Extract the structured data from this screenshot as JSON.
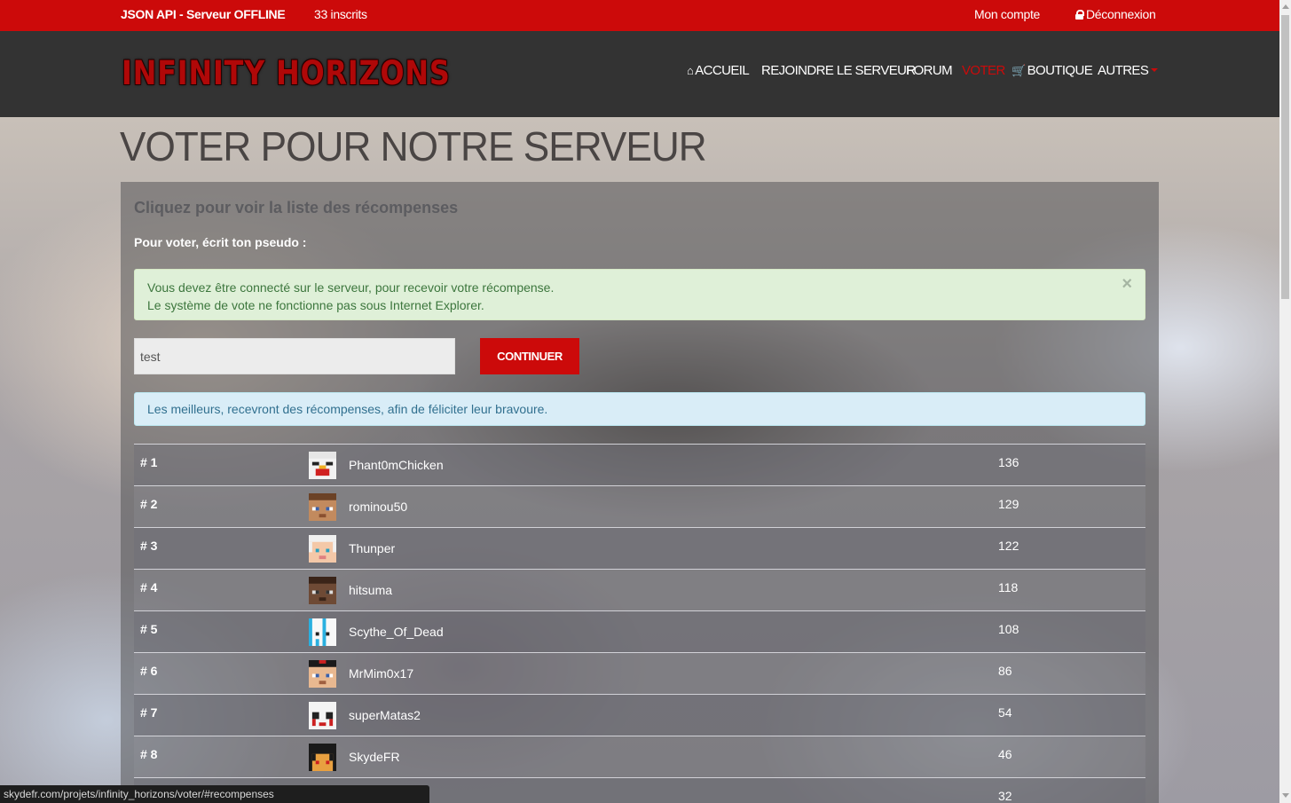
{
  "topbar": {
    "api_status": "JSON API - Serveur OFFLINE",
    "registered": "33 inscrits",
    "account": "Mon compte",
    "logout": "Déconnexion"
  },
  "brand": {
    "logo_text": "INFINITY HORIZONS"
  },
  "nav": {
    "items": [
      {
        "label": "ACCUEIL",
        "icon": "home-icon"
      },
      {
        "label": "REJOINDRE LE SERVEUR"
      },
      {
        "label": "FORUM"
      },
      {
        "label": "VOTER",
        "active": true
      },
      {
        "label": "BOUTIQUE",
        "icon": "cart-icon"
      },
      {
        "label": "AUTRES",
        "icon": "caret-down-icon"
      }
    ]
  },
  "page": {
    "title": "VOTER POUR NOTRE SERVEUR",
    "rewards_link": "Cliquez pour voir la liste des récompenses",
    "vote_label": "Pour voter, écrit ton pseudo :",
    "alert_success": {
      "line1": "Vous devez être connecté sur le serveur, pour recevoir votre récompense.",
      "line2": "Le système de vote ne fonctionne pas sous Internet Explorer.",
      "close": "×"
    },
    "pseudo_input_value": "test",
    "continue_button": "CONTINUER",
    "alert_info": "Les meilleurs, recevront des récompenses, afin de féliciter leur bravoure."
  },
  "ranking": [
    {
      "rank": "# 1",
      "pseudo": "Phant0mChicken",
      "votes": "136"
    },
    {
      "rank": "# 2",
      "pseudo": "rominou50",
      "votes": "129"
    },
    {
      "rank": "# 3",
      "pseudo": "Thunper",
      "votes": "122"
    },
    {
      "rank": "# 4",
      "pseudo": "hitsuma",
      "votes": "118"
    },
    {
      "rank": "# 5",
      "pseudo": "Scythe_Of_Dead",
      "votes": "108"
    },
    {
      "rank": "# 6",
      "pseudo": "MrMim0x17",
      "votes": "86"
    },
    {
      "rank": "# 7",
      "pseudo": "superMatas2",
      "votes": "54"
    },
    {
      "rank": "# 8",
      "pseudo": "SkydeFR",
      "votes": "46"
    },
    {
      "rank": "",
      "pseudo": "",
      "votes": "32"
    }
  ],
  "status_bar": "skydefr.com/projets/infinity_horizons/voter/#recompenses",
  "colors": {
    "brand_red": "#cc0a0a",
    "navbar": "#333333"
  }
}
